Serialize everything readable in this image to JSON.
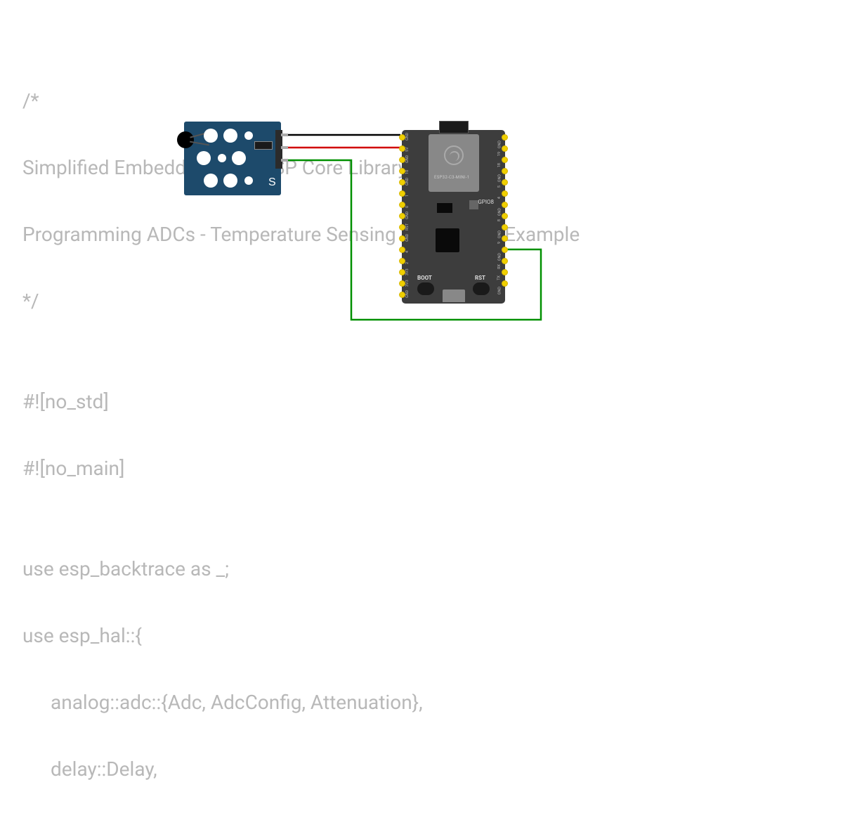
{
  "code": {
    "l1": "/*",
    "l2": "Simplified Embedded Rust: ESP Core Library Edition",
    "l3": "Programming ADCs - Temperature Sensing Application Example",
    "l4": "*/",
    "l5": "",
    "l6": "#![no_std]",
    "l7": "#![no_main]",
    "l8": "",
    "l9": "use esp_backtrace as _;",
    "l10": "use esp_hal::{",
    "l11": "analog::adc::{Adc, AdcConfig, Attenuation},",
    "l12": "delay::Delay,"
  },
  "sensor": {
    "label_s": "S"
  },
  "esp": {
    "model": "ESP32-C3-MINI-1",
    "gpio8": "GPIO8",
    "boot": "BOOT",
    "rst": "RST",
    "left_pins": [
      "GND",
      "5V",
      "GND",
      "10",
      "GND",
      "1",
      "0",
      "GND",
      "RST",
      "GND",
      "4",
      "2",
      "3V3",
      "3V3",
      "GND"
    ],
    "right_pins": [
      "GND",
      "19",
      "18",
      "GND",
      "5",
      "4",
      "GND",
      "8",
      "GND",
      "9",
      "GND",
      "RX",
      "TX",
      "GND"
    ]
  },
  "wires": {
    "black": "#000000",
    "red": "#d10000",
    "green": "#009000"
  }
}
